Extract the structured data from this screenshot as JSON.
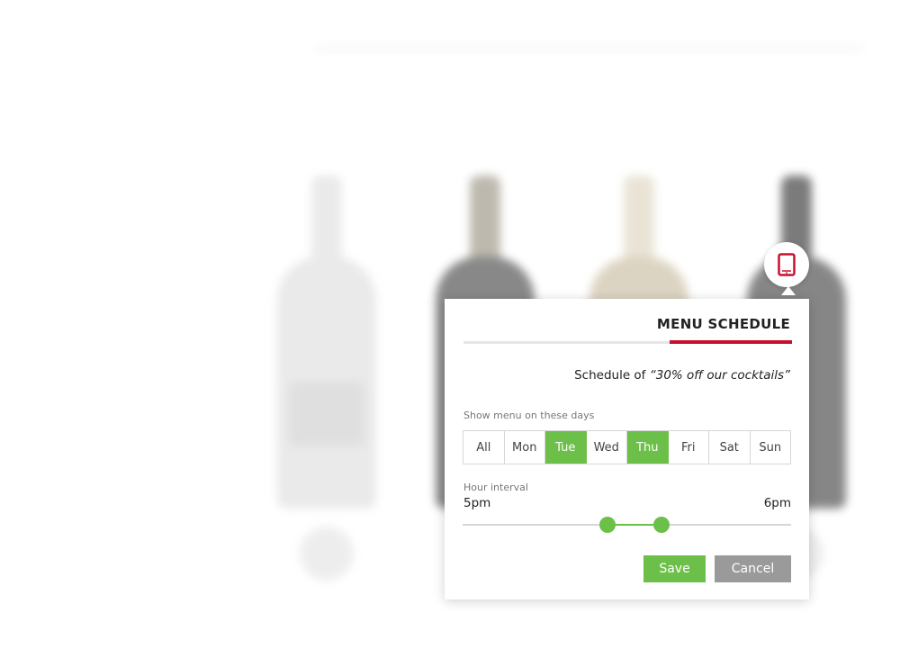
{
  "popup": {
    "title": "MENU SCHEDULE",
    "schedule_prefix": "Schedule of ",
    "schedule_name": "“30% off our cocktails”",
    "days_label": "Show menu on these days",
    "days": [
      {
        "label": "All",
        "selected": false
      },
      {
        "label": "Mon",
        "selected": false
      },
      {
        "label": "Tue",
        "selected": true
      },
      {
        "label": "Wed",
        "selected": false
      },
      {
        "label": "Thu",
        "selected": true
      },
      {
        "label": "Fri",
        "selected": false
      },
      {
        "label": "Sat",
        "selected": false
      },
      {
        "label": "Sun",
        "selected": false
      }
    ],
    "hour_label": "Hour interval",
    "hour_start": "5pm",
    "hour_end": "6pm",
    "save_label": "Save",
    "cancel_label": "Cancel"
  },
  "marker": {
    "icon": "tablet-icon"
  },
  "colors": {
    "accent_red": "#c8102e",
    "accent_green": "#6cc04a",
    "cancel_gray": "#9a9a9a"
  }
}
